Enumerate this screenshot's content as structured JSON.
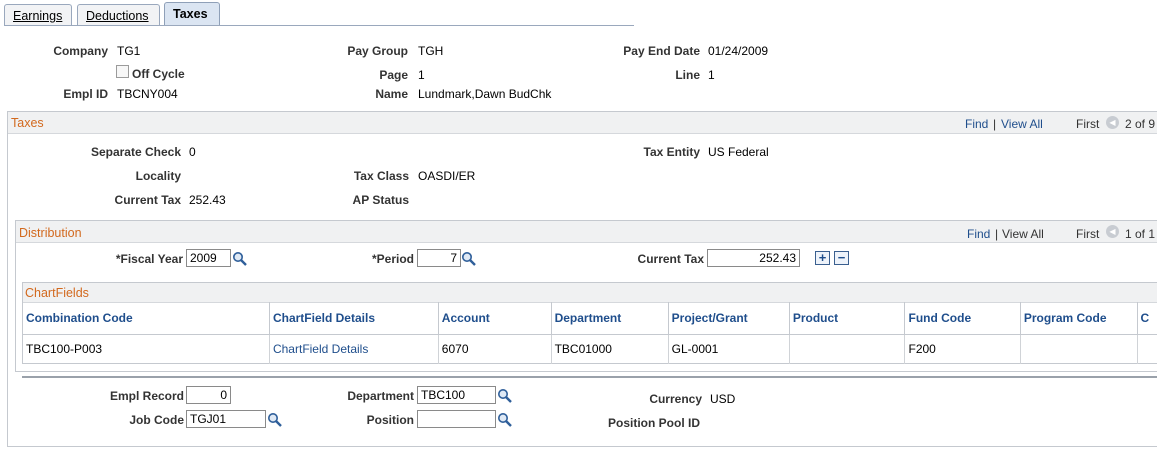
{
  "tabs": [
    "Earnings",
    "Deductions",
    "Taxes"
  ],
  "header": {
    "company_label": "Company",
    "company": "TG1",
    "pay_group_label": "Pay Group",
    "pay_group": "TGH",
    "pay_end_date_label": "Pay End Date",
    "pay_end_date": "01/24/2009",
    "off_cycle_label": "Off Cycle",
    "page_label": "Page",
    "page": "1",
    "line_label": "Line",
    "line": "1",
    "empl_id_label": "Empl ID",
    "empl_id": "TBCNY004",
    "name_label": "Name",
    "name": "Lundmark,Dawn BudChk"
  },
  "taxes": {
    "title": "Taxes",
    "find": "Find",
    "view_all": "View All",
    "first": "First",
    "count": "2 of 9",
    "separate_check_label": "Separate Check",
    "separate_check": "0",
    "tax_entity_label": "Tax Entity",
    "tax_entity": "US Federal",
    "locality_label": "Locality",
    "tax_class_label": "Tax Class",
    "tax_class": "OASDI/ER",
    "current_tax_label": "Current Tax",
    "current_tax": "252.43",
    "ap_status_label": "AP Status"
  },
  "distribution": {
    "title": "Distribution",
    "find": "Find",
    "view_all": "View All",
    "first": "First",
    "count": "1 of 1",
    "fiscal_year_label": "*Fiscal Year",
    "fiscal_year": "2009",
    "period_label": "*Period",
    "period": "7",
    "current_tax_label": "Current Tax",
    "current_tax": "252.43",
    "plus": "+",
    "minus": "−"
  },
  "chartfields": {
    "title": "ChartFields",
    "columns": [
      "Combination Code",
      "ChartField Details",
      "Account",
      "Department",
      "Project/Grant",
      "Product",
      "Fund Code",
      "Program Code",
      "C"
    ],
    "row": [
      "TBC100-P003",
      "ChartField Details",
      "6070",
      "TBC01000",
      "GL-0001",
      "",
      "F200",
      "",
      ""
    ]
  },
  "footer": {
    "empl_record_label": "Empl Record",
    "empl_record": "0",
    "department_label": "Department",
    "department": "TBC100",
    "currency_label": "Currency",
    "currency": "USD",
    "job_code_label": "Job Code",
    "job_code": "TGJ01",
    "position_label": "Position",
    "position": "",
    "position_pool_label": "Position Pool ID"
  },
  "colors": {
    "section_title": "#d2691e",
    "link": "#1f4e8c",
    "border": "#c5c9cf"
  },
  "icons": {
    "lookup": "magnifier-lookup-icon",
    "nav": "previous-arrow-icon"
  }
}
